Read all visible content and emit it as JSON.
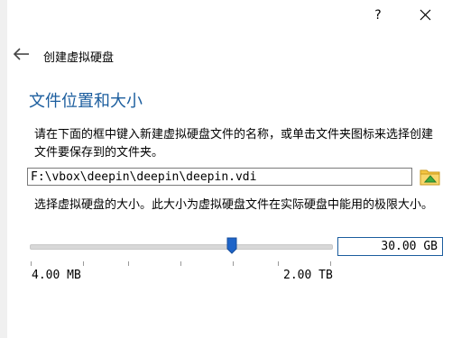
{
  "window": {
    "help_label": "?"
  },
  "header": {
    "title": "创建虚拟硬盘"
  },
  "section": {
    "heading": "文件位置和大小",
    "description": "请在下面的框中键入新建虚拟硬盘文件的名称，或单击文件夹图标来选择创建文件要保存到的文件夹。"
  },
  "file": {
    "path": "F:\\vbox\\deepin\\deepin\\deepin.vdi"
  },
  "size": {
    "description": "选择虚拟硬盘的大小。此大小为虚拟硬盘文件在实际硬盘中能用的极限大小。",
    "value": "30.00 GB",
    "min_label": "4.00 MB",
    "max_label": "2.00 TB",
    "slider_position": 0.67
  },
  "colors": {
    "accent": "#1b5d9e",
    "slider_handle": "#1e64c8",
    "folder": "#f5c542",
    "folder_arrow": "#3fae3f"
  }
}
